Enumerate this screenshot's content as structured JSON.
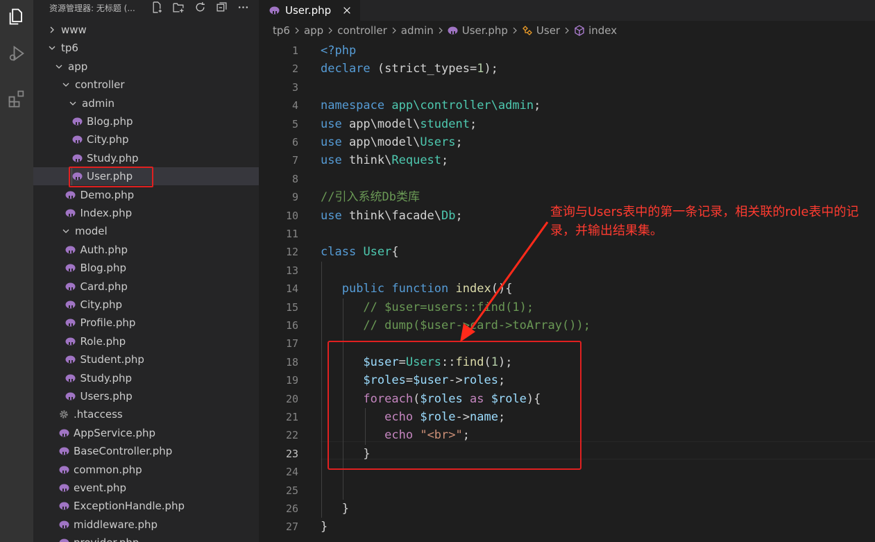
{
  "sidebar": {
    "title": "资源管理器: 无标题 (...",
    "actions": [
      "new-file-icon",
      "new-folder-icon",
      "refresh-icon",
      "collapse-icon",
      "more-icon"
    ],
    "items": [
      {
        "label": "www",
        "type": "folder",
        "open": false,
        "depth": 0
      },
      {
        "label": "tp6",
        "type": "folder",
        "open": true,
        "depth": 0
      },
      {
        "label": "app",
        "type": "folder",
        "open": true,
        "depth": 1
      },
      {
        "label": "controller",
        "type": "folder",
        "open": true,
        "depth": 2
      },
      {
        "label": "admin",
        "type": "folder",
        "open": true,
        "depth": 3
      },
      {
        "label": "Blog.php",
        "type": "php",
        "depth": 4
      },
      {
        "label": "City.php",
        "type": "php",
        "depth": 4
      },
      {
        "label": "Study.php",
        "type": "php",
        "depth": 4
      },
      {
        "label": "User.php",
        "type": "php",
        "depth": 4,
        "selected": true
      },
      {
        "label": "Demo.php",
        "type": "php",
        "depth": 3
      },
      {
        "label": "Index.php",
        "type": "php",
        "depth": 3
      },
      {
        "label": "model",
        "type": "folder",
        "open": true,
        "depth": 2
      },
      {
        "label": "Auth.php",
        "type": "php",
        "depth": 3
      },
      {
        "label": "Blog.php",
        "type": "php",
        "depth": 3
      },
      {
        "label": "Card.php",
        "type": "php",
        "depth": 3
      },
      {
        "label": "City.php",
        "type": "php",
        "depth": 3
      },
      {
        "label": "Profile.php",
        "type": "php",
        "depth": 3
      },
      {
        "label": "Role.php",
        "type": "php",
        "depth": 3
      },
      {
        "label": "Student.php",
        "type": "php",
        "depth": 3
      },
      {
        "label": "Study.php",
        "type": "php",
        "depth": 3
      },
      {
        "label": "Users.php",
        "type": "php",
        "depth": 3
      },
      {
        "label": ".htaccess",
        "type": "gear",
        "depth": 2
      },
      {
        "label": "AppService.php",
        "type": "php",
        "depth": 2
      },
      {
        "label": "BaseController.php",
        "type": "php",
        "depth": 2
      },
      {
        "label": "common.php",
        "type": "php",
        "depth": 2
      },
      {
        "label": "event.php",
        "type": "php",
        "depth": 2
      },
      {
        "label": "ExceptionHandle.php",
        "type": "php",
        "depth": 2
      },
      {
        "label": "middleware.php",
        "type": "php",
        "depth": 2
      },
      {
        "label": "provider.php",
        "type": "php",
        "depth": 2
      }
    ]
  },
  "tab": {
    "label": "User.php",
    "close": "×"
  },
  "breadcrumb": [
    "tp6",
    "app",
    "controller",
    "admin",
    "User.php",
    "User",
    "index"
  ],
  "editor": {
    "current_line": 23,
    "lines": [
      [
        [
          "kw",
          "<?php"
        ]
      ],
      [
        [
          "kw",
          "declare"
        ],
        [
          "plain",
          " (strict_types="
        ],
        [
          "num",
          "1"
        ],
        [
          "plain",
          ");"
        ]
      ],
      [],
      [
        [
          "kw",
          "namespace"
        ],
        [
          "plain",
          " "
        ],
        [
          "cls",
          "app\\controller\\admin"
        ],
        [
          "plain",
          ";"
        ]
      ],
      [
        [
          "kw",
          "use"
        ],
        [
          "plain",
          " app\\model\\"
        ],
        [
          "cls",
          "student"
        ],
        [
          "plain",
          ";"
        ]
      ],
      [
        [
          "kw",
          "use"
        ],
        [
          "plain",
          " app\\model\\"
        ],
        [
          "cls",
          "Users"
        ],
        [
          "plain",
          ";"
        ]
      ],
      [
        [
          "kw",
          "use"
        ],
        [
          "plain",
          " think\\"
        ],
        [
          "cls",
          "Request"
        ],
        [
          "plain",
          ";"
        ]
      ],
      [],
      [
        [
          "cmt",
          "//引入系统Db类库"
        ]
      ],
      [
        [
          "kw",
          "use"
        ],
        [
          "plain",
          " think\\facade\\"
        ],
        [
          "cls",
          "Db"
        ],
        [
          "plain",
          ";"
        ]
      ],
      [],
      [
        [
          "kw",
          "class"
        ],
        [
          "plain",
          " "
        ],
        [
          "cls",
          "User"
        ],
        [
          "plain",
          "{"
        ]
      ],
      [],
      [
        [
          "plain",
          "   "
        ],
        [
          "kw",
          "public"
        ],
        [
          "plain",
          " "
        ],
        [
          "kw",
          "function"
        ],
        [
          "plain",
          " "
        ],
        [
          "fn",
          "index"
        ],
        [
          "plain",
          "(){"
        ]
      ],
      [
        [
          "plain",
          "      "
        ],
        [
          "cmt",
          "// $user=users::find(1);"
        ]
      ],
      [
        [
          "plain",
          "      "
        ],
        [
          "cmt",
          "// dump($user->card->toArray());"
        ]
      ],
      [],
      [
        [
          "plain",
          "      "
        ],
        [
          "var",
          "$user"
        ],
        [
          "plain",
          "="
        ],
        [
          "cls",
          "Users"
        ],
        [
          "plain",
          "::"
        ],
        [
          "fn",
          "find"
        ],
        [
          "plain",
          "("
        ],
        [
          "num",
          "1"
        ],
        [
          "plain",
          ");"
        ]
      ],
      [
        [
          "plain",
          "      "
        ],
        [
          "var",
          "$roles"
        ],
        [
          "plain",
          "="
        ],
        [
          "var",
          "$user"
        ],
        [
          "plain",
          "->"
        ],
        [
          "var",
          "roles"
        ],
        [
          "plain",
          ";"
        ]
      ],
      [
        [
          "plain",
          "      "
        ],
        [
          "kc",
          "foreach"
        ],
        [
          "plain",
          "("
        ],
        [
          "var",
          "$roles"
        ],
        [
          "plain",
          " "
        ],
        [
          "kc",
          "as"
        ],
        [
          "plain",
          " "
        ],
        [
          "var",
          "$role"
        ],
        [
          "plain",
          "){"
        ]
      ],
      [
        [
          "plain",
          "         "
        ],
        [
          "kc",
          "echo"
        ],
        [
          "plain",
          " "
        ],
        [
          "var",
          "$role"
        ],
        [
          "plain",
          "->"
        ],
        [
          "var",
          "name"
        ],
        [
          "plain",
          ";"
        ]
      ],
      [
        [
          "plain",
          "         "
        ],
        [
          "kc",
          "echo"
        ],
        [
          "plain",
          " "
        ],
        [
          "str",
          "\"<br>\""
        ],
        [
          "plain",
          ";"
        ]
      ],
      [
        [
          "plain",
          "      }"
        ]
      ],
      [],
      [],
      [
        [
          "plain",
          "   }"
        ]
      ],
      [
        [
          "plain",
          "}"
        ]
      ]
    ]
  },
  "annotation": {
    "text": "查询与Users表中的第一条记录，相关联的role表中的记录，并输出结果集。"
  },
  "colors": {
    "highlight": "#e02020",
    "annotation": "#ff3b30",
    "php_icon": "#a074c4"
  }
}
